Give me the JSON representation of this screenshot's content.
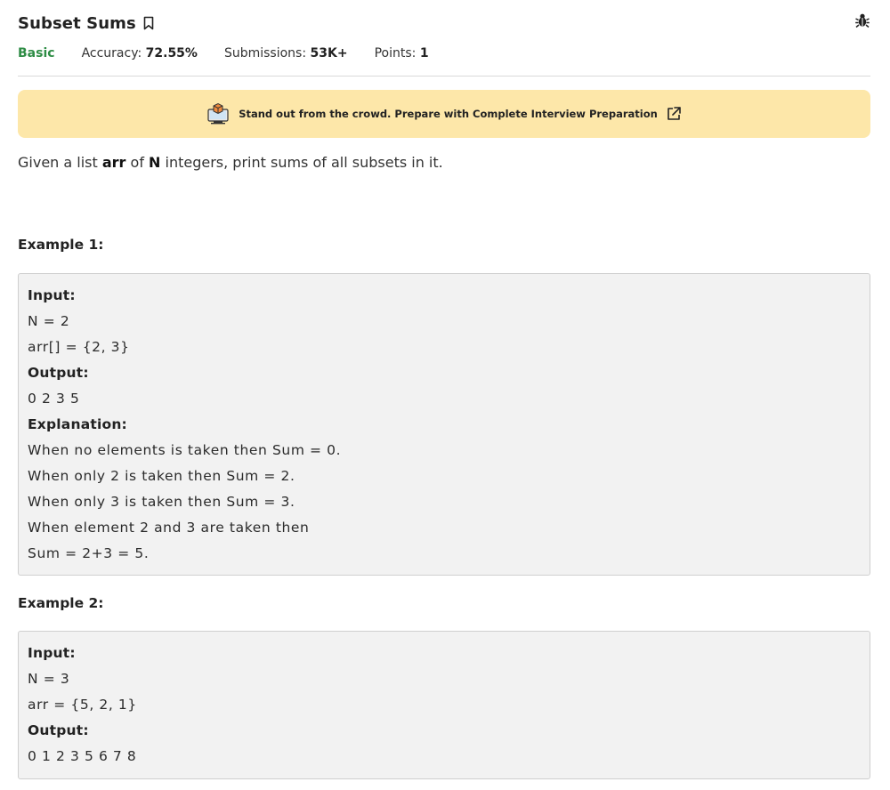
{
  "header": {
    "title": "Subset Sums",
    "difficulty": "Basic",
    "accuracy_label": "Accuracy: ",
    "accuracy_value": "72.55%",
    "submissions_label": "Submissions: ",
    "submissions_value": "53K+",
    "points_label": "Points: ",
    "points_value": "1"
  },
  "banner": {
    "text": "Stand out from the crowd. Prepare with Complete Interview Preparation"
  },
  "statement": {
    "p1": "Given a list ",
    "arr": "arr",
    "p2": " of ",
    "n": "N",
    "p3": " integers, print sums of all subsets in it."
  },
  "example1": {
    "title": "Example 1:",
    "input_label": "Input:",
    "input_lines": [
      "N = 2",
      "arr[] = {2, 3}"
    ],
    "output_label": "Output:",
    "output_lines": [
      "0 2 3 5"
    ],
    "explanation_label": "Explanation:",
    "explanation_lines": [
      "When no elements is taken then Sum = 0.",
      "When only 2 is taken then Sum = 2.",
      "When only 3 is taken then Sum = 3.",
      "When element 2 and 3 are taken then",
      "Sum = 2+3 = 5."
    ]
  },
  "example2": {
    "title": "Example 2:",
    "input_label": "Input:",
    "input_lines": [
      "N = 3",
      "arr = {5, 2, 1}"
    ],
    "output_label": "Output:",
    "output_lines": [
      "0 1 2 3 5 6 7 8"
    ]
  },
  "icons": {
    "bookmark": "bookmark-icon",
    "bug": "bug-icon",
    "banner": "laptop-box-icon",
    "external": "external-link-icon"
  },
  "colors": {
    "difficulty": "#2f8d46",
    "banner_bg": "#fde7a9",
    "code_bg": "#f2f2f2"
  }
}
